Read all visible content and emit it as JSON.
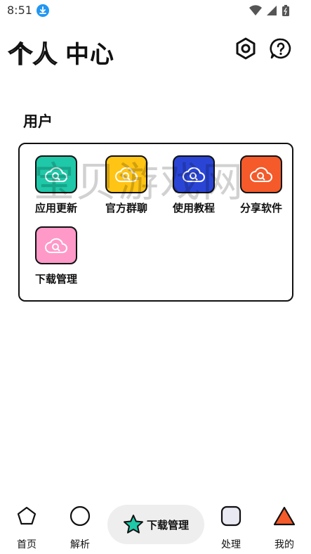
{
  "status_bar": {
    "time": "8:51"
  },
  "header": {
    "title_outline": "个人",
    "title_bold": "中心"
  },
  "section": {
    "title": "用户"
  },
  "grid": {
    "items": [
      {
        "label": "应用更新",
        "color": "#1ec8a8"
      },
      {
        "label": "官方群聊",
        "color": "#ffc414"
      },
      {
        "label": "使用教程",
        "color": "#2a45d6"
      },
      {
        "label": "分享软件",
        "color": "#f45a2a"
      },
      {
        "label": "下载管理",
        "color": "#ff99c8"
      }
    ]
  },
  "watermark": "宝贝游戏网",
  "bottom_nav": {
    "items": [
      {
        "label": "首页",
        "icon": "pentagon-icon"
      },
      {
        "label": "解析",
        "icon": "circle-icon"
      },
      {
        "label": "下载管理",
        "icon": "star-icon",
        "active": true,
        "color": "#1ec8a8"
      },
      {
        "label": "处理",
        "icon": "rounded-square-icon"
      },
      {
        "label": "我的",
        "icon": "triangle-icon",
        "color": "#f45a2a"
      }
    ]
  }
}
